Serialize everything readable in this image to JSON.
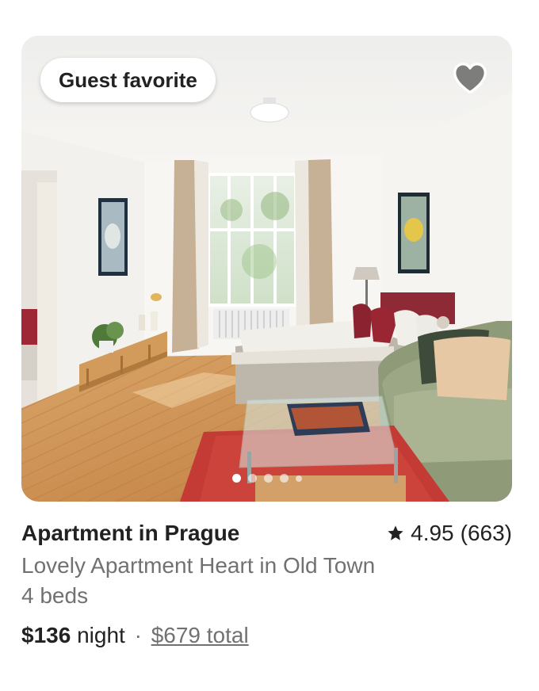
{
  "listing": {
    "badge": "Guest favorite",
    "title": "Apartment in Prague",
    "rating_value": "4.95",
    "rating_count": "(663)",
    "subtitle": "Lovely Apartment Heart in Old Town",
    "beds": "4 beds",
    "price": "$136",
    "price_unit": "night",
    "separator": "·",
    "total": "$679 total"
  },
  "carousel": {
    "photo_count": 5,
    "active_index": 0
  },
  "icons": {
    "favorite": "heart-icon",
    "rating": "star-icon"
  },
  "colors": {
    "text_primary": "#222222",
    "text_secondary": "#717171",
    "badge_bg": "#ffffff"
  }
}
